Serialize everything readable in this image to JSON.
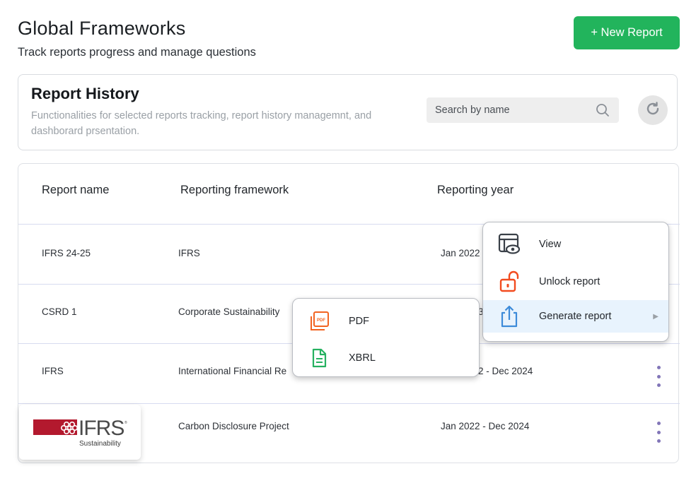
{
  "header": {
    "title": "Global Frameworks",
    "subtitle": "Track reports progress and manage questions",
    "new_report_label": "+ New Report"
  },
  "history": {
    "title": "Report History",
    "description": "Functionalities for selected reports tracking, report history managemnt, and dashborard prsentation.",
    "search_placeholder": "Search by name"
  },
  "table": {
    "columns": [
      "Report name",
      "Reporting framework",
      "Reporting year"
    ],
    "rows": [
      {
        "name": "IFRS 24-25",
        "framework": "IFRS",
        "year": "Jan 2022"
      },
      {
        "name": "CSRD 1",
        "framework": "Corporate Sustainability",
        "year": "3"
      },
      {
        "name": "IFRS",
        "framework": "International Financial Re",
        "year": "2 - Dec 2024"
      },
      {
        "name": "",
        "framework": "Carbon Disclosure Project",
        "year": "Jan 2022 - Dec 2024"
      }
    ]
  },
  "logo": {
    "brand": "IFRS",
    "caption": "Sustainability",
    "brand_color": "#b3192e"
  },
  "context_menu": {
    "items": [
      {
        "label": "View",
        "icon": "view-report-icon"
      },
      {
        "label": "Unlock report",
        "icon": "unlock-icon"
      },
      {
        "label": "Generate report",
        "icon": "share-export-icon"
      }
    ]
  },
  "submenu": {
    "items": [
      {
        "label": "PDF",
        "icon": "pdf-file-icon",
        "icon_text": "PDF"
      },
      {
        "label": "XBRL",
        "icon": "document-icon"
      }
    ]
  },
  "colors": {
    "accent_green": "#22b45c",
    "kebab_purple": "#8276b8",
    "menu_icon_dark": "#3a4048",
    "unlock_red": "#f24b1f",
    "share_blue": "#3d8bd9",
    "pdf_orange": "#f26422",
    "xbrl_green": "#25b160"
  }
}
